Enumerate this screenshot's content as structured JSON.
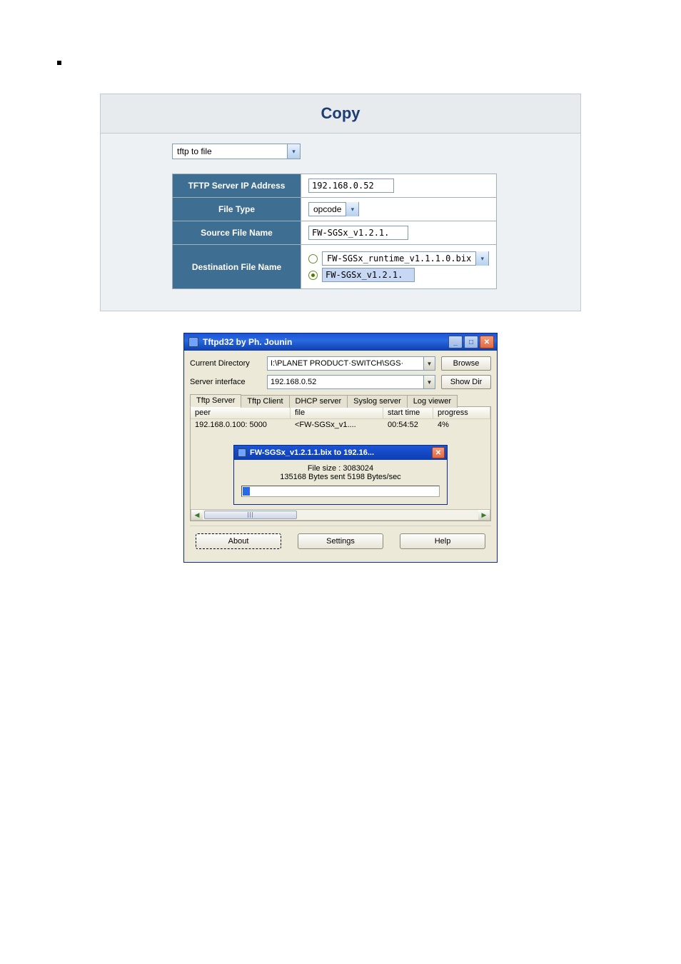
{
  "bullet_square_glyph": "■",
  "copy_panel": {
    "title": "Copy",
    "mode_select": "tftp to file",
    "rows": {
      "ip_label": "TFTP Server IP Address",
      "ip_value": "192.168.0.52",
      "file_type_label": "File Type",
      "file_type_value": "opcode",
      "source_label": "Source File Name",
      "source_value": "FW-SGSx_v1.2.1.",
      "dest_label": "Destination File Name",
      "dest_option_unselected": "FW-SGSx_runtime_v1.1.1.0.bix",
      "dest_option_selected": "FW-SGSx_v1.2.1."
    }
  },
  "tftpd": {
    "title": "Tftpd32 by Ph. Jounin",
    "cur_dir_label": "Current Directory",
    "cur_dir_value": "I:\\PLANET PRODUCT·SWITCH\\SGS·",
    "server_if_label": "Server interface",
    "server_if_value": "  192.168.0.52",
    "browse_btn": "Browse",
    "showdir_btn": "Show Dir",
    "tabs": [
      "Tftp Server",
      "Tftp Client",
      "DHCP server",
      "Syslog server",
      "Log viewer"
    ],
    "cols": {
      "peer": "peer",
      "file": "file",
      "start": "start time",
      "progress": "progress"
    },
    "row": {
      "peer": "192.168.0.100: 5000",
      "file": "<FW-SGSx_v1....",
      "start": "00:54:52",
      "progress": "4%"
    },
    "progress_dialog": {
      "title": "FW-SGSx_v1.2.1.1.bix to 192.16...",
      "size_line": "File size : 3083024",
      "rate_line": "135168 Bytes sent         5198 Bytes/sec",
      "chunks": 1
    },
    "buttons": {
      "about": "About",
      "settings": "Settings",
      "help": "Help"
    }
  }
}
